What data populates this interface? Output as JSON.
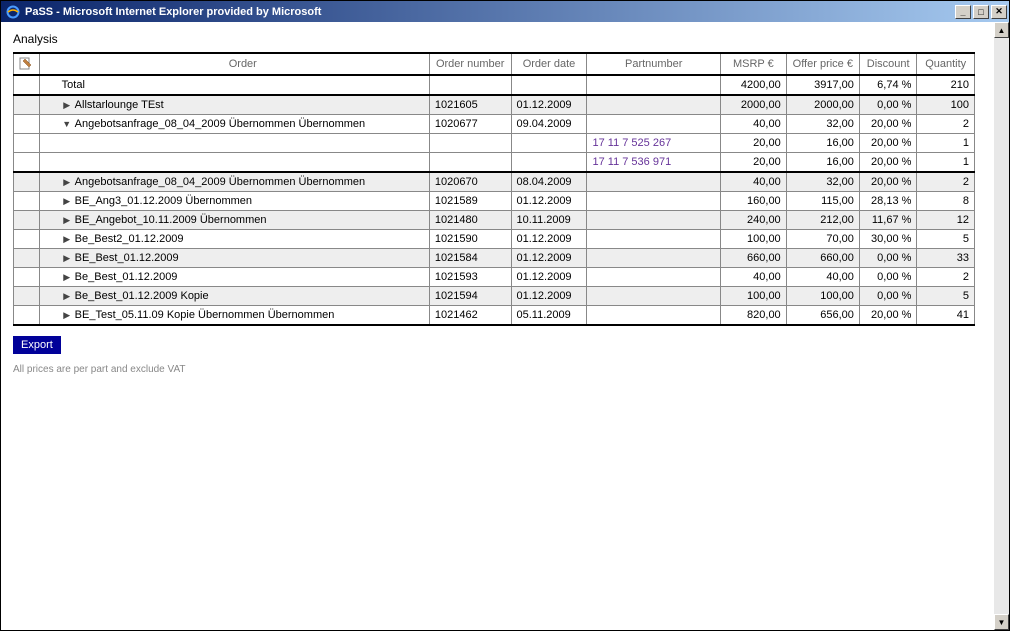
{
  "window": {
    "title": "PaSS - Microsoft Internet Explorer provided by Microsoft"
  },
  "heading": "Analysis",
  "columns": {
    "order": "Order",
    "number": "Order number",
    "date": "Order date",
    "part": "Partnumber",
    "msrp": "MSRP €",
    "offer": "Offer price €",
    "disc": "Discount",
    "qty": "Quantity"
  },
  "totalRow": {
    "label": "Total",
    "msrp": "4200,00",
    "offer": "3917,00",
    "disc": "6,74 %",
    "qty": "210"
  },
  "rows": [
    {
      "type": "order",
      "shaded": true,
      "expanded": false,
      "order": "Allstarlounge TEst",
      "number": "1021605",
      "date": "01.12.2009",
      "part": "",
      "msrp": "2000,00",
      "offer": "2000,00",
      "disc": "0,00 %",
      "qty": "100"
    },
    {
      "type": "order",
      "shaded": false,
      "expanded": true,
      "order": "Angebotsanfrage_08_04_2009 Übernommen Übernommen",
      "number": "1020677",
      "date": "09.04.2009",
      "part": "",
      "msrp": "40,00",
      "offer": "32,00",
      "disc": "20,00 %",
      "qty": "2"
    },
    {
      "type": "part",
      "shaded": false,
      "order": "",
      "number": "",
      "date": "",
      "part": "17 11 7 525 267",
      "msrp": "20,00",
      "offer": "16,00",
      "disc": "20,00 %",
      "qty": "1"
    },
    {
      "type": "part",
      "shaded": false,
      "order": "",
      "number": "",
      "date": "",
      "part": "17 11 7 536 971",
      "msrp": "20,00",
      "offer": "16,00",
      "disc": "20,00 %",
      "qty": "1",
      "sectionEnd": true
    },
    {
      "type": "order",
      "shaded": true,
      "expanded": false,
      "order": "Angebotsanfrage_08_04_2009 Übernommen Übernommen",
      "number": "1020670",
      "date": "08.04.2009",
      "part": "",
      "msrp": "40,00",
      "offer": "32,00",
      "disc": "20,00 %",
      "qty": "2"
    },
    {
      "type": "order",
      "shaded": false,
      "expanded": false,
      "order": "BE_Ang3_01.12.2009 Übernommen",
      "number": "1021589",
      "date": "01.12.2009",
      "part": "",
      "msrp": "160,00",
      "offer": "115,00",
      "disc": "28,13 %",
      "qty": "8"
    },
    {
      "type": "order",
      "shaded": true,
      "expanded": false,
      "order": "BE_Angebot_10.11.2009 Übernommen",
      "number": "1021480",
      "date": "10.11.2009",
      "part": "",
      "msrp": "240,00",
      "offer": "212,00",
      "disc": "11,67 %",
      "qty": "12"
    },
    {
      "type": "order",
      "shaded": false,
      "expanded": false,
      "order": "Be_Best2_01.12.2009",
      "number": "1021590",
      "date": "01.12.2009",
      "part": "",
      "msrp": "100,00",
      "offer": "70,00",
      "disc": "30,00 %",
      "qty": "5"
    },
    {
      "type": "order",
      "shaded": true,
      "expanded": false,
      "order": "BE_Best_01.12.2009",
      "number": "1021584",
      "date": "01.12.2009",
      "part": "",
      "msrp": "660,00",
      "offer": "660,00",
      "disc": "0,00 %",
      "qty": "33"
    },
    {
      "type": "order",
      "shaded": false,
      "expanded": false,
      "order": "Be_Best_01.12.2009",
      "number": "1021593",
      "date": "01.12.2009",
      "part": "",
      "msrp": "40,00",
      "offer": "40,00",
      "disc": "0,00 %",
      "qty": "2"
    },
    {
      "type": "order",
      "shaded": true,
      "expanded": false,
      "order": "Be_Best_01.12.2009 Kopie",
      "number": "1021594",
      "date": "01.12.2009",
      "part": "",
      "msrp": "100,00",
      "offer": "100,00",
      "disc": "0,00 %",
      "qty": "5"
    },
    {
      "type": "order",
      "shaded": false,
      "expanded": false,
      "order": "BE_Test_05.11.09 Kopie Übernommen Übernommen",
      "number": "1021462",
      "date": "05.11.2009",
      "part": "",
      "msrp": "820,00",
      "offer": "656,00",
      "disc": "20,00 %",
      "qty": "41",
      "sectionEnd": true
    }
  ],
  "exportBtn": "Export",
  "footnote": "All prices are per part and exclude VAT"
}
